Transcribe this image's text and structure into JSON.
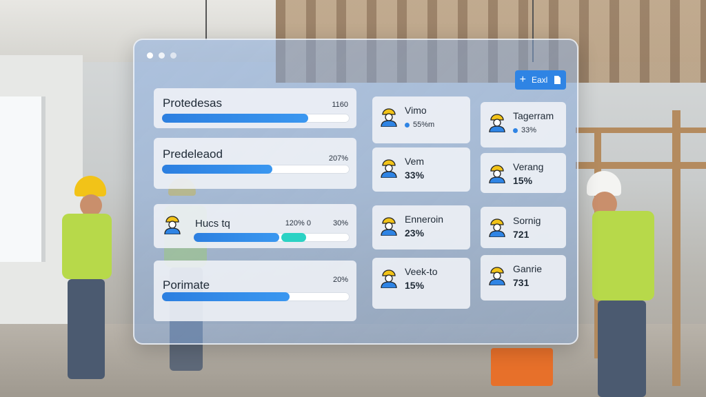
{
  "panel": {
    "edit_button": {
      "label": "Eaxl",
      "icon": "plus-icon",
      "badge_icon": "document-icon"
    },
    "progress_items": [
      {
        "label": "Protedesas",
        "value_text": "1160",
        "progress": 0.78
      },
      {
        "label": "Predeleaod",
        "value_text": "207%",
        "progress": 0.59
      },
      {
        "label": "Hucs tq",
        "value_text": "30%",
        "extra_text": "120% 0",
        "progress": 0.55,
        "teal_segment": 0.16
      },
      {
        "label": "Porimate",
        "value_text": "20%",
        "progress": 0.68
      }
    ],
    "workers": [
      {
        "name": "Vimo",
        "stat": "55%m",
        "stat_style": "small"
      },
      {
        "name": "Tagerram",
        "stat": "33%",
        "stat_style": "small"
      },
      {
        "name": "Vem",
        "stat": "33%",
        "stat_style": "bold"
      },
      {
        "name": "Verang",
        "stat": "15%",
        "stat_style": "bold"
      },
      {
        "name": "Enneroin",
        "stat": "23%",
        "stat_style": "bold"
      },
      {
        "name": "Sornig",
        "stat": "721",
        "stat_style": "bold"
      },
      {
        "name": "Veek-to",
        "stat": "15%",
        "stat_style": "bold"
      },
      {
        "name": "Ganrie",
        "stat": "731",
        "stat_style": "bold"
      }
    ],
    "avatar_icon": "construction-worker-icon",
    "colors": {
      "accent": "#2f84e4",
      "teal": "#2bd2c4",
      "hat_yellow": "#f2c318"
    }
  }
}
